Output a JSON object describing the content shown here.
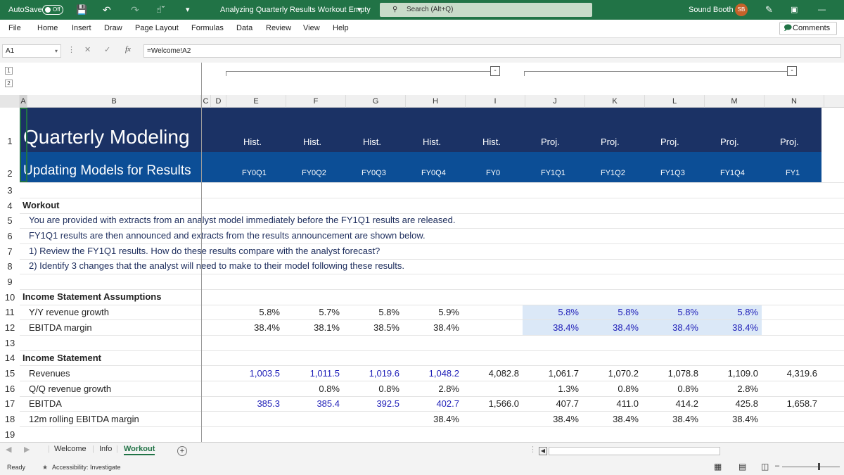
{
  "titlebar": {
    "autosave_label": "AutoSave",
    "autosave_state": "Off",
    "document_title": "Analyzing Quarterly Results Workout Empty",
    "search_placeholder": "Search (Alt+Q)",
    "user_name": "Sound Booth",
    "user_initials": "SB"
  },
  "menu": {
    "items": [
      "File",
      "Home",
      "Insert",
      "Draw",
      "Page Layout",
      "Formulas",
      "Data",
      "Review",
      "View",
      "Help"
    ],
    "comments_label": "Comments"
  },
  "formula_bar": {
    "name_box": "A1",
    "fx_label": "fx",
    "formula": "=Welcome!A2"
  },
  "outline": {
    "levels": [
      "1",
      "2"
    ],
    "collapse_label": "-"
  },
  "columns": [
    "A",
    "B",
    "C",
    "D",
    "E",
    "F",
    "G",
    "H",
    "I",
    "J",
    "K",
    "L",
    "M",
    "N"
  ],
  "rows": [
    "1",
    "2",
    "3",
    "4",
    "5",
    "6",
    "7",
    "8",
    "9",
    "10",
    "11",
    "12",
    "13",
    "14",
    "15",
    "16",
    "17",
    "18",
    "19"
  ],
  "sheet": {
    "title": "Quarterly Modeling",
    "subtitle": "Updating Models for Results",
    "period_types": [
      "Hist.",
      "Hist.",
      "Hist.",
      "Hist.",
      "Hist.",
      "Proj.",
      "Proj.",
      "Proj.",
      "Proj.",
      "Proj."
    ],
    "periods": [
      "FY0Q1",
      "FY0Q2",
      "FY0Q3",
      "FY0Q4",
      "FY0",
      "FY1Q1",
      "FY1Q2",
      "FY1Q3",
      "FY1Q4",
      "FY1"
    ],
    "workout_heading": "Workout",
    "workout_lines": [
      "You are provided with extracts from an analyst model immediately before the FY1Q1 results are released.",
      "FY1Q1 results are then announced and extracts from the results announcement are shown below.",
      "1) Review the FY1Q1 results. How do these results compare with the analyst forecast?",
      "2) Identify 3 changes that the analyst will need to make to their model following these results."
    ],
    "assumptions_heading": "Income Statement Assumptions",
    "assumption_rows": [
      {
        "label": "Y/Y revenue growth",
        "values": [
          "5.8%",
          "5.7%",
          "5.8%",
          "5.9%",
          "",
          "5.8%",
          "5.8%",
          "5.8%",
          "5.8%",
          ""
        ]
      },
      {
        "label": "EBITDA margin",
        "values": [
          "38.4%",
          "38.1%",
          "38.5%",
          "38.4%",
          "",
          "38.4%",
          "38.4%",
          "38.4%",
          "38.4%",
          ""
        ]
      }
    ],
    "income_heading": "Income Statement",
    "income_rows": [
      {
        "label": "Revenues",
        "values": [
          "1,003.5",
          "1,011.5",
          "1,019.6",
          "1,048.2",
          "4,082.8",
          "1,061.7",
          "1,070.2",
          "1,078.8",
          "1,109.0",
          "4,319.6"
        ]
      },
      {
        "label": "Q/Q revenue growth",
        "values": [
          "",
          "0.8%",
          "0.8%",
          "2.8%",
          "",
          "1.3%",
          "0.8%",
          "0.8%",
          "2.8%",
          ""
        ]
      },
      {
        "label": "EBITDA",
        "values": [
          "385.3",
          "385.4",
          "392.5",
          "402.7",
          "1,566.0",
          "407.7",
          "411.0",
          "414.2",
          "425.8",
          "1,658.7"
        ]
      },
      {
        "label": "12m rolling EBITDA margin",
        "values": [
          "",
          "",
          "",
          "38.4%",
          "",
          "38.4%",
          "38.4%",
          "38.4%",
          "38.4%",
          ""
        ]
      }
    ]
  },
  "tabs": {
    "items": [
      "Welcome",
      "Info",
      "Workout"
    ],
    "active": "Workout",
    "add_label": "+"
  },
  "status": {
    "ready": "Ready",
    "accessibility": "Accessibility: Investigate"
  },
  "colors": {
    "excel_green": "#217346",
    "navy_header": "#1b3265",
    "blue_header": "#0c4e96",
    "input_blue": "#1f1fb8",
    "input_shade": "#dbe8f7"
  }
}
